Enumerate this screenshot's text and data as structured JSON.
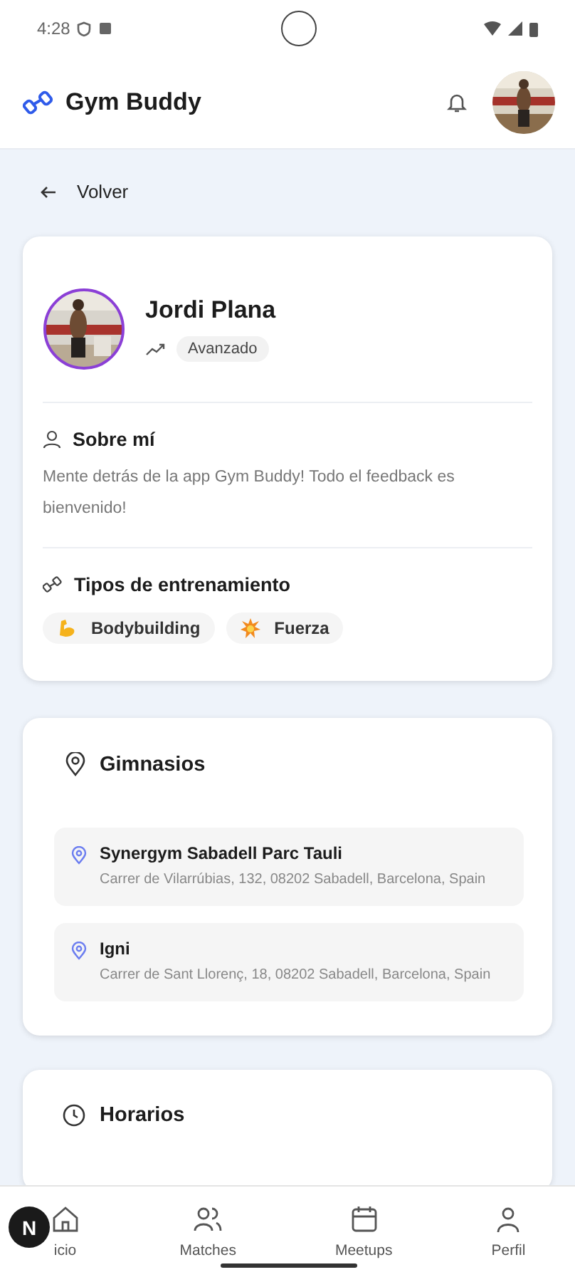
{
  "status_bar": {
    "time": "4:28"
  },
  "header": {
    "title": "Gym Buddy"
  },
  "back": {
    "label": "Volver"
  },
  "profile": {
    "name": "Jordi Plana",
    "level": "Avanzado"
  },
  "about": {
    "title": "Sobre mí",
    "text": "Mente detrás de la app Gym Buddy! Todo el feedback es bienvenido!"
  },
  "training": {
    "title": "Tipos de entrenamiento",
    "types": [
      {
        "kind": "muscle",
        "label": "Bodybuilding"
      },
      {
        "kind": "burst",
        "label": "Fuerza"
      }
    ]
  },
  "gyms": {
    "title": "Gimnasios",
    "items": [
      {
        "name": "Synergym Sabadell Parc Tauli",
        "address": "Carrer de Vilarrúbias, 132, 08202 Sabadell, Barcelona, Spain"
      },
      {
        "name": "Igni",
        "address": "Carrer de Sant Llorenç, 18, 08202 Sabadell, Barcelona, Spain"
      }
    ]
  },
  "schedule": {
    "title": "Horarios"
  },
  "nav": [
    {
      "kind": "home",
      "label": "icio"
    },
    {
      "kind": "people",
      "label": "Matches"
    },
    {
      "kind": "calendar",
      "label": "Meetups"
    },
    {
      "kind": "person",
      "label": "Perfil"
    }
  ],
  "dev_badge": {
    "label": "N"
  }
}
